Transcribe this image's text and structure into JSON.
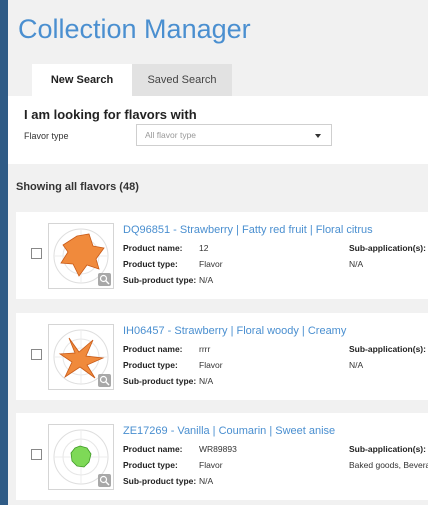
{
  "app": {
    "title": "Collection Manager"
  },
  "tabs": [
    {
      "label": "New Search",
      "active": true
    },
    {
      "label": "Saved Search",
      "active": false
    }
  ],
  "search": {
    "heading": "I am looking for flavors with",
    "flavor_type_label": "Flavor type",
    "flavor_type_value": "All flavor type"
  },
  "results": {
    "summary": "Showing all flavors (48)",
    "labels": {
      "product_name": "Product name:",
      "product_type": "Product type:",
      "sub_product_type": "Sub-product type:",
      "sub_application": "Sub-application(s):"
    },
    "items": [
      {
        "title": "DQ96851 - Strawberry | Fatty red fruit | Floral citrus",
        "product_name": "12",
        "product_type": "Flavor",
        "sub_product_type": "N/A",
        "sub_application": "N/A",
        "shape_color": "#f08a3c"
      },
      {
        "title": "IH06457 - Strawberry | Floral woody | Creamy",
        "product_name": "rrrr",
        "product_type": "Flavor",
        "sub_product_type": "N/A",
        "sub_application": "N/A",
        "shape_color": "#f08a3c"
      },
      {
        "title": "ZE17269 - Vanilla | Coumarin | Sweet anise",
        "product_name": "WR89893",
        "product_type": "Flavor",
        "sub_product_type": "N/A",
        "sub_application": "Baked goods, Beverage",
        "shape_color": "#7ed957"
      }
    ]
  },
  "colors": {
    "accent": "#4a8fd0",
    "frame": "#2f5b86",
    "page_background": "#f1f1f1"
  },
  "icons": [
    "search-icon",
    "chevron-down-icon",
    "radar-chart-icon"
  ]
}
